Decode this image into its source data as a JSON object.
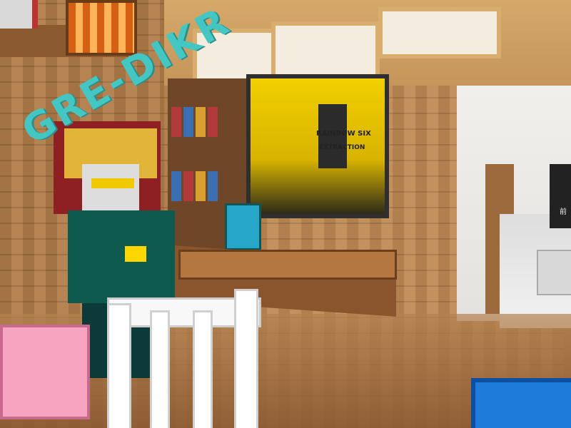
{
  "scene": {
    "watermark": "GRE-DIKR",
    "poster": {
      "brand": "RAINBOW SIX",
      "title": "EXTRACTION"
    },
    "tv_text": "前"
  },
  "colors": {
    "wall": "#b27d4a",
    "poster_yellow": "#f1d000",
    "watermark": "#44c7c3",
    "figure_teal": "#0f5a4f",
    "pink_block": "#f7a4c0",
    "blue_block": "#1f7bd8"
  }
}
